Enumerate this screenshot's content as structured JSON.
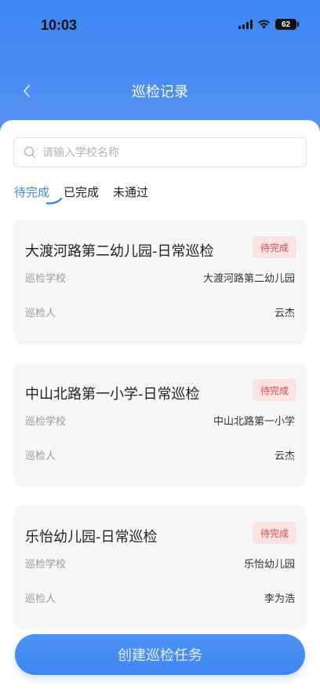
{
  "status": {
    "time": "10:03",
    "battery": "62"
  },
  "nav": {
    "title": "巡检记录"
  },
  "search": {
    "placeholder": "请输入学校名称"
  },
  "tabs": [
    {
      "label": "待完成",
      "active": true
    },
    {
      "label": "已完成",
      "active": false
    },
    {
      "label": "未通过",
      "active": false
    }
  ],
  "records": [
    {
      "title": "大渡河路第二幼儿园-日常巡检",
      "status": "待完成",
      "school_label": "巡检学校",
      "school": "大渡河路第二幼儿园",
      "inspector_label": "巡检人",
      "inspector": "云杰"
    },
    {
      "title": "中山北路第一小学-日常巡检",
      "status": "待完成",
      "school_label": "巡检学校",
      "school": "中山北路第一小学",
      "inspector_label": "巡检人",
      "inspector": "云杰"
    },
    {
      "title": "乐怡幼儿园-日常巡检",
      "status": "待完成",
      "school_label": "巡检学校",
      "school": "乐怡幼儿园",
      "inspector_label": "巡检人",
      "inspector": "李为浩"
    }
  ],
  "create_button": {
    "label": "创建巡检任务"
  },
  "colors": {
    "primary": "#3f86f2",
    "badge_bg": "#fbe3e3",
    "badge_text": "#e04a4a",
    "card_bg": "#f7f7f8"
  }
}
